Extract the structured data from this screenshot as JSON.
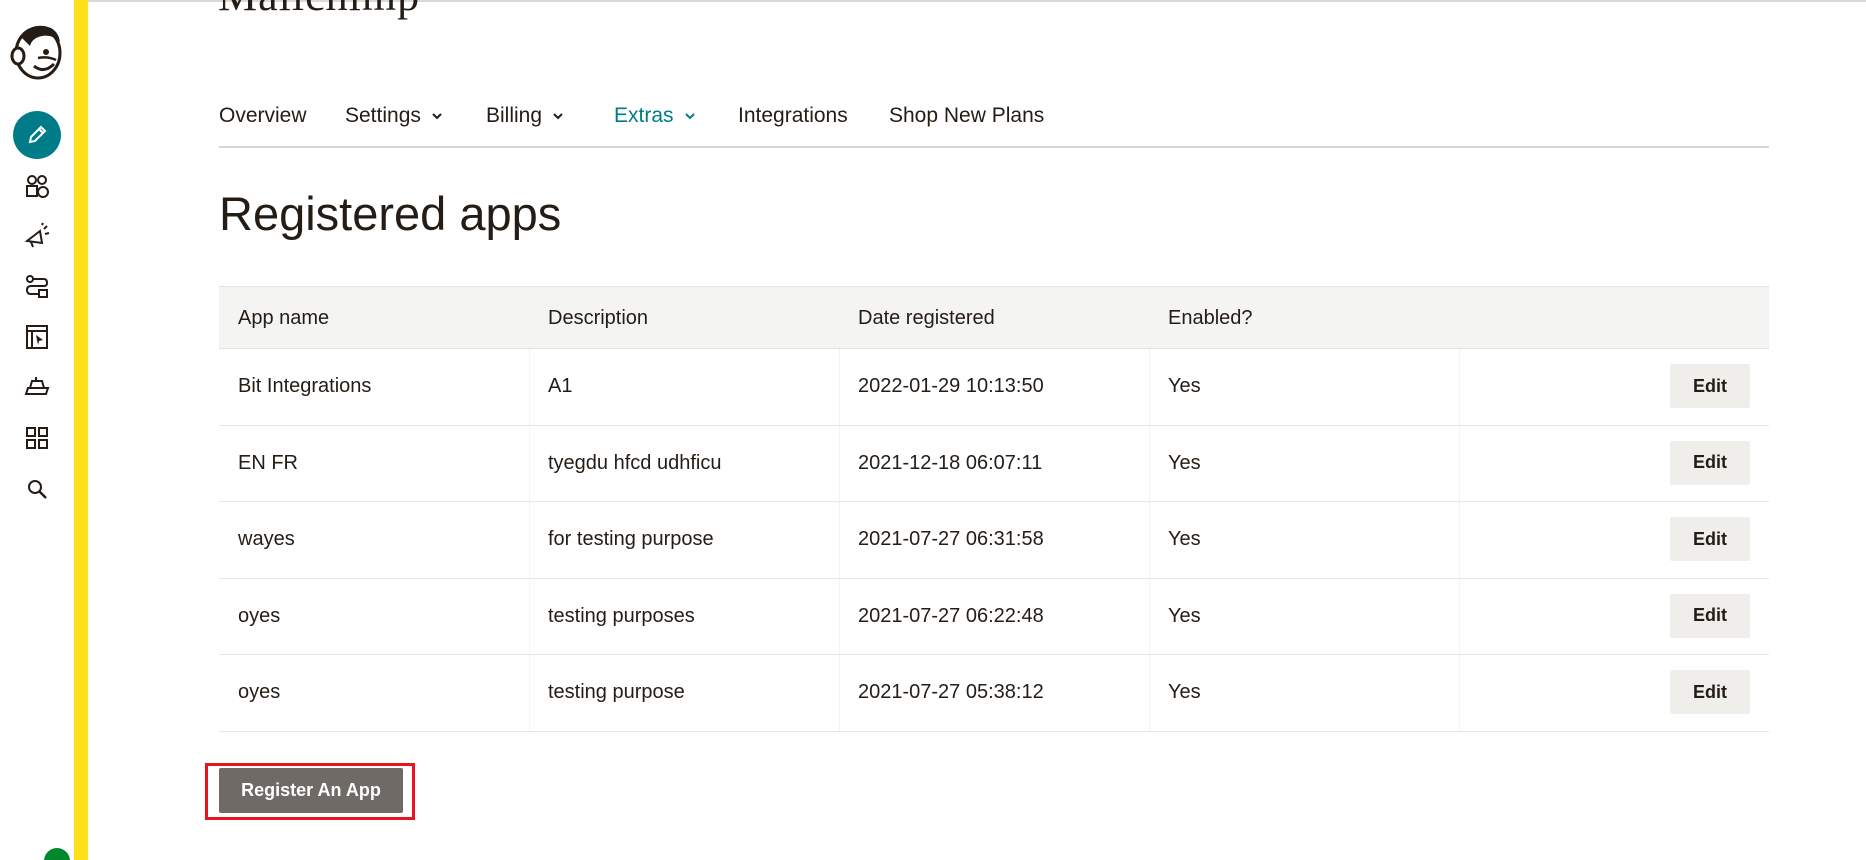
{
  "brand": {
    "text": "Mailchimp"
  },
  "sidebar": {
    "items": [
      {
        "icon": "pencil-icon",
        "active": true
      },
      {
        "icon": "audience-icon"
      },
      {
        "icon": "megaphone-icon"
      },
      {
        "icon": "automation-icon"
      },
      {
        "icon": "website-icon"
      },
      {
        "icon": "content-icon"
      },
      {
        "icon": "grid-icon"
      },
      {
        "icon": "search-icon"
      }
    ],
    "accent_color": "#007c89",
    "stripe_color": "#ffe01b"
  },
  "nav": {
    "tabs": [
      {
        "label": "Overview",
        "dropdown": false
      },
      {
        "label": "Settings",
        "dropdown": true
      },
      {
        "label": "Billing",
        "dropdown": true
      },
      {
        "label": "Extras",
        "dropdown": true,
        "active": true
      },
      {
        "label": "Integrations",
        "dropdown": false
      },
      {
        "label": "Shop New Plans",
        "dropdown": false
      }
    ]
  },
  "page": {
    "title": "Registered apps"
  },
  "table": {
    "headers": [
      "App name",
      "Description",
      "Date registered",
      "Enabled?"
    ],
    "edit_label": "Edit",
    "rows": [
      {
        "name": "Bit Integrations",
        "description": "A1",
        "date": "2022-01-29 10:13:50",
        "enabled": "Yes"
      },
      {
        "name": "EN FR",
        "description": "tyegdu hfcd udhficu",
        "date": "2021-12-18 06:07:11",
        "enabled": "Yes"
      },
      {
        "name": "wayes",
        "description": "for testing purpose",
        "date": "2021-07-27 06:31:58",
        "enabled": "Yes"
      },
      {
        "name": "oyes",
        "description": "testing purposes",
        "date": "2021-07-27 06:22:48",
        "enabled": "Yes"
      },
      {
        "name": "oyes",
        "description": "testing purpose",
        "date": "2021-07-27 05:38:12",
        "enabled": "Yes"
      }
    ]
  },
  "actions": {
    "register_label": "Register An App",
    "highlight_color": "#e8131f"
  }
}
